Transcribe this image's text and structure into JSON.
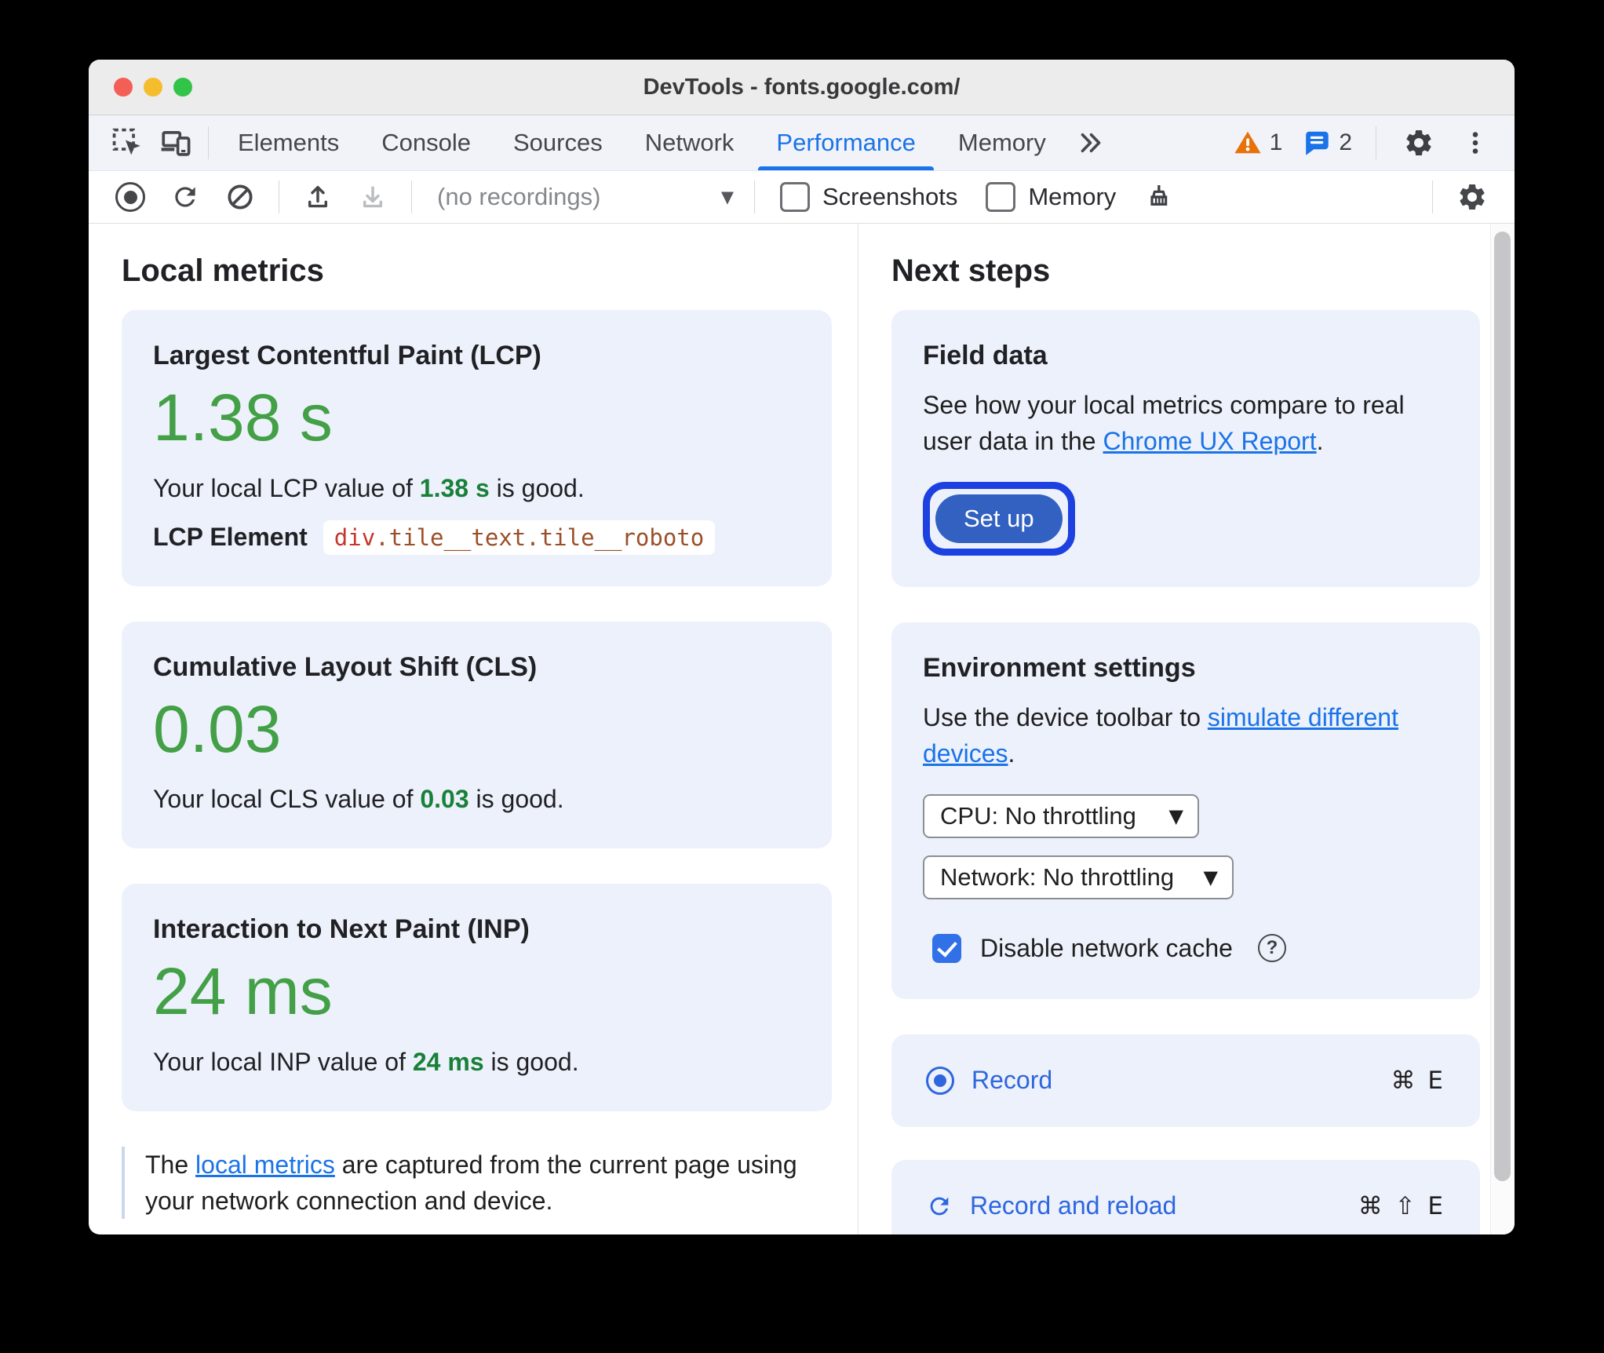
{
  "window": {
    "title": "DevTools - fonts.google.com/"
  },
  "tabs": {
    "items": [
      "Elements",
      "Console",
      "Sources",
      "Network",
      "Performance",
      "Memory"
    ],
    "active": "Performance",
    "warning_count": "1",
    "message_count": "2"
  },
  "toolbar": {
    "recordings_select": "(no recordings)",
    "screenshots_label": "Screenshots",
    "memory_label": "Memory"
  },
  "icons": {
    "select_arrow": "▼",
    "help_glyph": "?"
  },
  "local_metrics": {
    "title": "Local metrics",
    "lcp": {
      "title": "Largest Contentful Paint (LCP)",
      "value": "1.38 s",
      "desc_prefix": "Your local LCP value of ",
      "desc_value": "1.38 s",
      "desc_suffix": " is good.",
      "element_label": "LCP Element",
      "element_tag": "div",
      "element_classes": ".tile__text.tile__roboto"
    },
    "cls": {
      "title": "Cumulative Layout Shift (CLS)",
      "value": "0.03",
      "desc_prefix": "Your local CLS value of ",
      "desc_value": "0.03",
      "desc_suffix": " is good."
    },
    "inp": {
      "title": "Interaction to Next Paint (INP)",
      "value": "24 ms",
      "desc_prefix": "Your local INP value of ",
      "desc_value": "24 ms",
      "desc_suffix": " is good."
    },
    "footer": {
      "prefix": "The ",
      "link": "local metrics",
      "suffix": " are captured from the current page using your network connection and device."
    }
  },
  "next_steps": {
    "title": "Next steps",
    "field_data": {
      "title": "Field data",
      "desc_prefix": "See how your local metrics compare to real user data in the ",
      "link": "Chrome UX Report",
      "desc_suffix": ".",
      "button_label": "Set up"
    },
    "environment": {
      "title": "Environment settings",
      "desc_prefix": "Use the device toolbar to ",
      "link": "simulate different devices",
      "desc_suffix": ".",
      "cpu_select": "CPU: No throttling",
      "network_select": "Network: No throttling",
      "cache_label": "Disable network cache"
    },
    "record": {
      "label": "Record",
      "shortcut": "⌘ E"
    },
    "record_reload": {
      "label": "Record and reload",
      "shortcut": "⌘ ⇧ E"
    }
  },
  "colors": {
    "accent_blue": "#1a73e8",
    "link_blue": "#1a73e8",
    "metric_green_large": "#43a047",
    "metric_green_inline": "#188038",
    "warning_orange": "#e8710a",
    "setup_button_blue": "#3261c2",
    "focus_ring_blue": "#1d40e0",
    "checkbox_blue": "#3270e8",
    "card_background": "#edf1fb",
    "element_tag_red": "#c5362c",
    "element_class_brown": "#9a4f29",
    "traffic_red": "#f35e57",
    "traffic_yellow": "#f5bd2e",
    "traffic_green": "#31c448"
  }
}
